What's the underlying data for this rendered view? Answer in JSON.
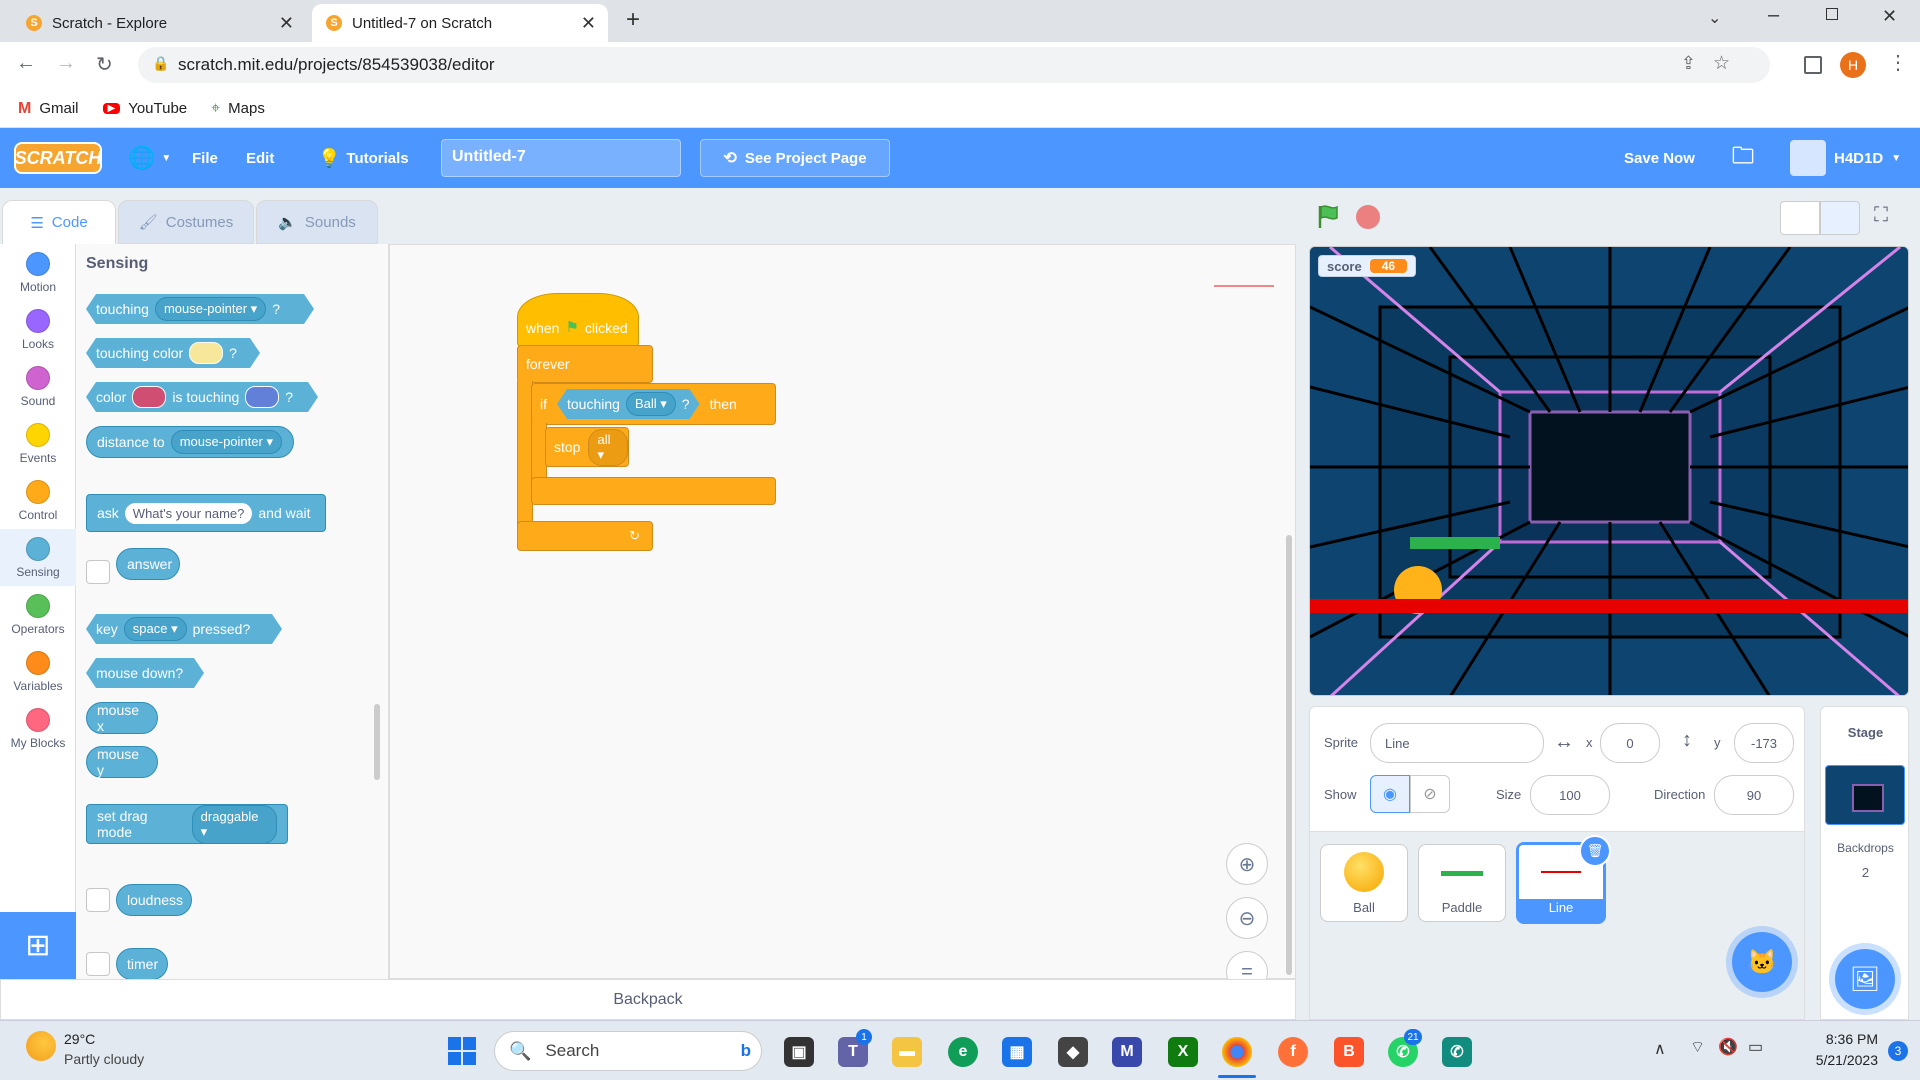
{
  "browser": {
    "tabs": [
      {
        "title": "Scratch - Explore",
        "active": false
      },
      {
        "title": "Untitled-7 on Scratch",
        "active": true
      }
    ],
    "url": "scratch.mit.edu/projects/854539038/editor",
    "profile_initial": "H",
    "bookmarks": [
      "Gmail",
      "YouTube",
      "Maps"
    ]
  },
  "menubar": {
    "logo": "SCRATCH",
    "file": "File",
    "edit": "Edit",
    "tutorials": "Tutorials",
    "project_title": "Untitled-7",
    "see_project_page": "See Project Page",
    "save_now": "Save Now",
    "username": "H4D1D"
  },
  "editor_tabs": {
    "code": "Code",
    "costumes": "Costumes",
    "sounds": "Sounds"
  },
  "categories": [
    {
      "label": "Motion",
      "color": "#4c97ff"
    },
    {
      "label": "Looks",
      "color": "#9966ff"
    },
    {
      "label": "Sound",
      "color": "#cf63cf"
    },
    {
      "label": "Events",
      "color": "#ffd500"
    },
    {
      "label": "Control",
      "color": "#ffab19"
    },
    {
      "label": "Sensing",
      "color": "#5cb1d6"
    },
    {
      "label": "Operators",
      "color": "#59c059"
    },
    {
      "label": "Variables",
      "color": "#ff8c1a"
    },
    {
      "label": "My Blocks",
      "color": "#ff6680"
    }
  ],
  "palette": {
    "heading": "Sensing",
    "touching": "touching",
    "touching_dd": "mouse-pointer",
    "q": "?",
    "touching_color": "touching color",
    "color": "color",
    "is_touching": "is touching",
    "distance_to": "distance to",
    "distance_dd": "mouse-pointer",
    "ask": "ask",
    "ask_input": "What's your name?",
    "and_wait": "and wait",
    "answer": "answer",
    "key": "key",
    "key_dd": "space",
    "pressed": "pressed?",
    "mouse_down": "mouse down?",
    "mouse_x": "mouse x",
    "mouse_y": "mouse y",
    "set_drag_mode": "set drag mode",
    "drag_dd": "draggable",
    "loudness": "loudness",
    "timer": "timer"
  },
  "script": {
    "when": "when",
    "clicked": "clicked",
    "forever": "forever",
    "if": "if",
    "touching": "touching",
    "touching_dd": "Ball",
    "q": "?",
    "then": "then",
    "stop": "stop",
    "stop_dd": "all"
  },
  "backpack": "Backpack",
  "stage": {
    "score_label": "score",
    "score_value": "46"
  },
  "sprite_info": {
    "sprite_label": "Sprite",
    "sprite_name": "Line",
    "x_label": "x",
    "x": "0",
    "y_label": "y",
    "y": "-173",
    "show_label": "Show",
    "size_label": "Size",
    "size": "100",
    "direction_label": "Direction",
    "direction": "90"
  },
  "sprites": [
    {
      "name": "Ball",
      "selected": false
    },
    {
      "name": "Paddle",
      "selected": false
    },
    {
      "name": "Line",
      "selected": true
    }
  ],
  "stage_pane": {
    "title": "Stage",
    "backdrops_label": "Backdrops",
    "backdrops_count": "2"
  },
  "taskbar": {
    "temp": "29°C",
    "weather": "Partly cloudy",
    "search": "Search",
    "time": "8:36 PM",
    "date": "5/21/2023",
    "notif_count": "3",
    "teams_badge": "1",
    "whatsapp_badge": "21"
  }
}
